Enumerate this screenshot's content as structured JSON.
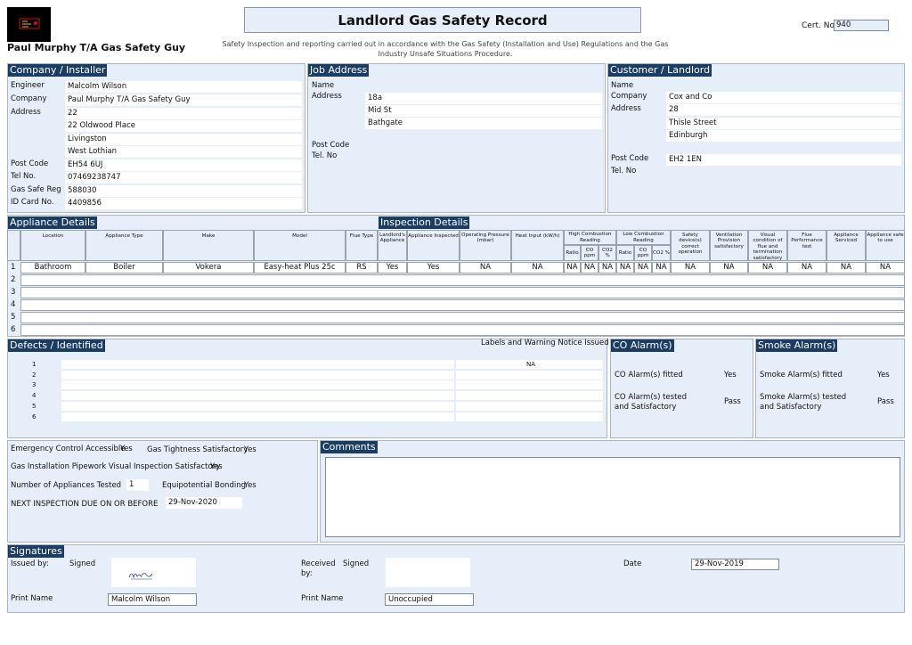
{
  "header": {
    "title": "Landlord Gas Safety Record",
    "business_name": "Paul Murphy T/A Gas Safety Guy",
    "subtitle": "Safety Inspection and reporting carried out in accordance with the Gas Safety (Installation and Use) Regulations and the Gas Industry Unsafe Situations Procedure.",
    "cert_label": "Cert. No.",
    "cert_no": "940"
  },
  "company": {
    "title": "Company / Installer",
    "engineer_label": "Engineer",
    "engineer": "Malcolm Wilson",
    "company_label": "Company",
    "company": "Paul Murphy T/A Gas Safety Guy",
    "address_label": "Address",
    "address": [
      "22",
      "22 Oldwood Place",
      "Livingston",
      "West Lothian"
    ],
    "postcode_label": "Post Code",
    "postcode": "EH54 6UJ",
    "tel_label": "Tel No.",
    "tel": "07469238747",
    "gassafe_label": "Gas Safe Reg",
    "gassafe": "588030",
    "idcard_label": "ID Card No.",
    "idcard": "4409856"
  },
  "job": {
    "title": "Job Address",
    "name_label": "Name",
    "name": "",
    "address_label": "Address",
    "address": [
      "18a",
      "Mid St",
      "Bathgate"
    ],
    "postcode_label": "Post Code",
    "postcode": "",
    "tel_label": "Tel. No",
    "tel": ""
  },
  "customer": {
    "title": "Customer / Landlord",
    "name_label": "Name",
    "name": "",
    "company_label": "Company",
    "company": "Cox and Co",
    "address_label": "Address",
    "address": [
      "28",
      "Thisle Street",
      "Edinburgh"
    ],
    "postcode_label": "Post Code",
    "postcode": "EH2 1EN",
    "tel_label": "Tel. No",
    "tel": ""
  },
  "appliances": {
    "details_title": "Appliance Details",
    "inspection_title": "Inspection Details",
    "headers": {
      "location": "Location",
      "type": "Appliance Type",
      "make": "Make",
      "model": "Model",
      "flue_type": "Flue Type",
      "landlords": "Landlord's Appliance",
      "inspected": "Appliance Inspected",
      "op_pressure": "Operating Pressure (mbar)",
      "heat_input": "Heat Input (kW/h)",
      "high_comb": "High Combustion Reading",
      "low_comb": "Low Combustion Reading",
      "ratio": "Ratio",
      "co_ppm": "CO ppm",
      "co2": "CO2 %",
      "safety_device": "Safety device(s) correct operation",
      "ventilation": "Ventilation Provision satisfactory",
      "visual": "Visual condition of flue and termination satisfactory",
      "flue_perf": "Flue Performance test",
      "serviced": "Appliance Serviced",
      "safe": "Appliance safe to use"
    },
    "rows": [
      {
        "num": "1",
        "location": "Bathroom",
        "type": "Boiler",
        "make": "Vokera",
        "model": "Easy-heat Plus 25c",
        "flue_type": "RS",
        "landlords": "Yes",
        "inspected": "Yes",
        "op_pressure": "NA",
        "heat_input": "NA",
        "h_ratio": "NA",
        "h_co": "NA",
        "h_co2": "NA",
        "l_ratio": "NA",
        "l_co": "NA",
        "l_co2": "NA",
        "safety": "NA",
        "ventilation": "NA",
        "visual": "NA",
        "flue_perf": "NA",
        "serviced": "NA",
        "safe": "NA"
      }
    ],
    "blank_row_numbers": [
      "2",
      "3",
      "4",
      "5",
      "6"
    ]
  },
  "defects": {
    "title": "Defects / Identified",
    "labels_heading": "Labels and Warning Notice Issued",
    "rows": [
      {
        "num": "1",
        "defect": "",
        "label": "NA"
      },
      {
        "num": "2",
        "defect": "",
        "label": ""
      },
      {
        "num": "3",
        "defect": "",
        "label": ""
      },
      {
        "num": "4",
        "defect": "",
        "label": ""
      },
      {
        "num": "5",
        "defect": "",
        "label": ""
      },
      {
        "num": "6",
        "defect": "",
        "label": ""
      }
    ]
  },
  "co_alarm": {
    "title": "CO Alarm(s)",
    "fitted_label": "CO Alarm(s) fitted",
    "fitted": "Yes",
    "tested_label_1": "CO Alarm(s) tested",
    "tested_label_2": "and Satisfactory",
    "tested": "Pass"
  },
  "smoke_alarm": {
    "title": "Smoke Alarm(s)",
    "fitted_label": "Smoke Alarm(s) fitted",
    "fitted": "Yes",
    "tested_label_1": "Smoke Alarm(s) tested",
    "tested_label_2": "and Satisfactory",
    "tested": "Pass"
  },
  "checks": {
    "emergency_label": "Emergency Control Accessible",
    "emergency": "Yes",
    "tightness_label": "Gas Tightness Satisfactory",
    "tightness": "Yes",
    "pipework_label": "Gas Installation Pipework Visual Inspection Satisfactory",
    "pipework": "Yes",
    "num_appliances_label": "Number of Appliances Tested",
    "num_appliances": "1",
    "bonding_label": "Equipotential Bonding",
    "bonding": "Yes",
    "next_label": "NEXT INSPECTION DUE ON OR BEFORE",
    "next": "29-Nov-2020"
  },
  "comments": {
    "title": "Comments",
    "text": ""
  },
  "signatures": {
    "title": "Signatures",
    "issued_by_label": "Issued by:",
    "signed_label": "Signed",
    "received_by_label": "Received by:",
    "received_signed_label": "Signed",
    "date_label": "Date",
    "date": "29-Nov-2019",
    "print_name_label": "Print Name",
    "issued_print_name": "Malcolm Wilson",
    "received_print_name_label": "Print Name",
    "received_print_name": "Unoccupied"
  }
}
